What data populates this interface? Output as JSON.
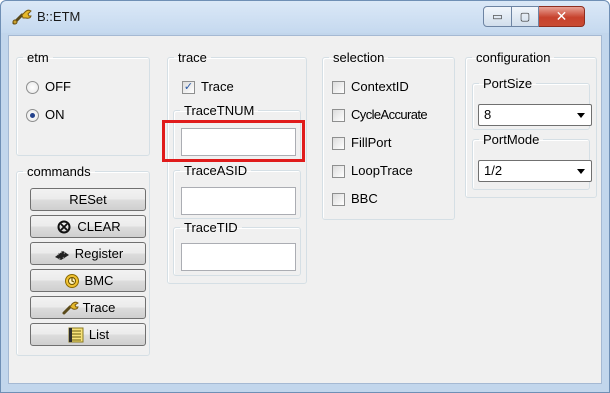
{
  "window": {
    "title": "B::ETM",
    "app_icon": "wrench-icon",
    "buttons": {
      "minimize_icon": "minimize-icon",
      "maximize_icon": "maximize-icon",
      "close_icon": "close-icon",
      "minimize": "▭",
      "maximize": "▢",
      "close": "✕"
    }
  },
  "etm": {
    "legend": "etm",
    "options": [
      {
        "label": "OFF",
        "checked": false
      },
      {
        "label": "ON",
        "checked": true
      }
    ]
  },
  "commands": {
    "legend": "commands",
    "buttons": [
      {
        "label": "RESet",
        "icon": ""
      },
      {
        "label": "CLEAR",
        "icon": "clear-icon"
      },
      {
        "label": "Register",
        "icon": "register-chip-icon"
      },
      {
        "label": "BMC",
        "icon": "bmc-icon"
      },
      {
        "label": "Trace",
        "icon": "wrench-icon"
      },
      {
        "label": "List",
        "icon": "list-icon"
      }
    ]
  },
  "trace": {
    "legend": "trace",
    "checkbox_label": "Trace",
    "checkbox_checked": true,
    "tracetnum": {
      "legend": "TraceTNUM",
      "value": ""
    },
    "traceasid": {
      "legend": "TraceASID",
      "value": ""
    },
    "tracetid": {
      "legend": "TraceTID",
      "value": ""
    }
  },
  "selection": {
    "legend": "selection",
    "items": [
      {
        "label": "ContextID",
        "checked": false
      },
      {
        "label": "CycleAccurate",
        "checked": false
      },
      {
        "label": "FillPort",
        "checked": false
      },
      {
        "label": "LoopTrace",
        "checked": false
      },
      {
        "label": "BBC",
        "checked": false
      }
    ]
  },
  "configuration": {
    "legend": "configuration",
    "portsize": {
      "legend": "PortSize",
      "value": "8"
    },
    "portmode": {
      "legend": "PortMode",
      "value": "1/2"
    }
  },
  "annotation": {
    "color": "#e01b1b"
  }
}
